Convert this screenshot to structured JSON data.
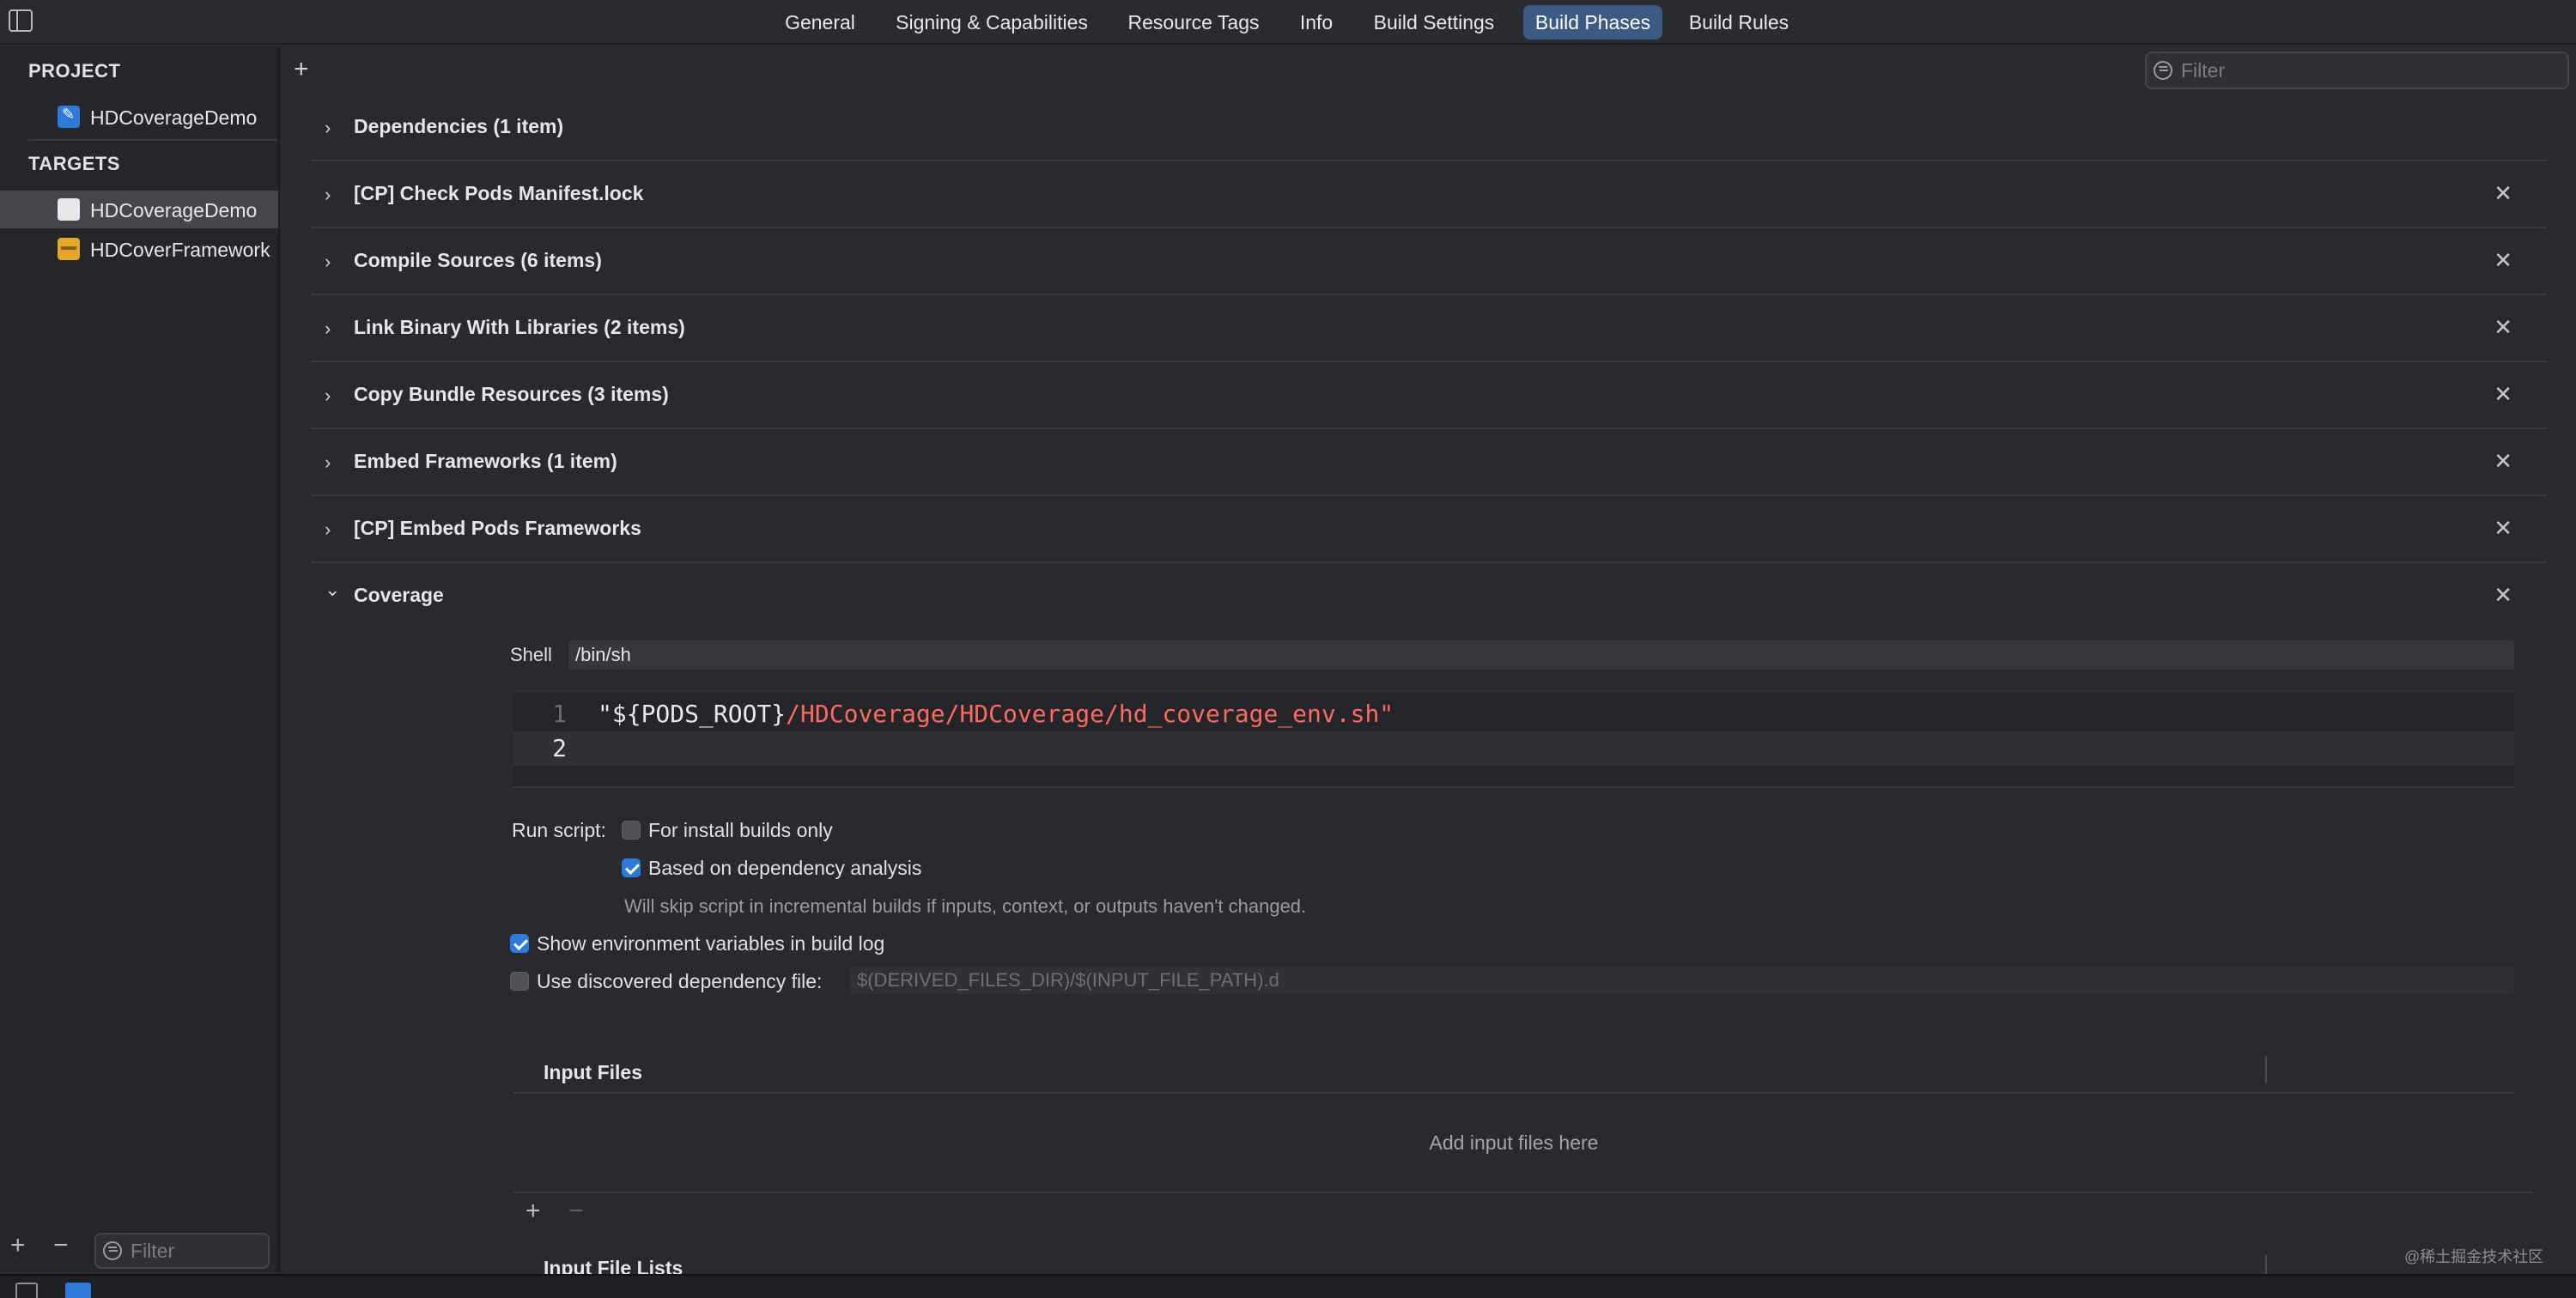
{
  "top_tabs": {
    "general": "General",
    "signing": "Signing & Capabilities",
    "resource_tags": "Resource Tags",
    "info": "Info",
    "build_settings": "Build Settings",
    "build_phases": "Build Phases",
    "build_rules": "Build Rules",
    "active": "Build Phases"
  },
  "search": {
    "filter_placeholder": "Filter"
  },
  "sidebar": {
    "project_heading": "PROJECT",
    "project_item": "HDCoverageDemo",
    "targets_heading": "TARGETS",
    "targets": [
      {
        "label": "HDCoverageDemo",
        "selected": true
      },
      {
        "label": "HDCoverFramework",
        "selected": false
      }
    ],
    "add_symbol": "+",
    "remove_symbol": "−",
    "filter_placeholder": "Filter"
  },
  "main": {
    "add_symbol": "+",
    "phases": [
      {
        "title": "Dependencies (1 item)",
        "closable": false
      },
      {
        "title": "[CP] Check Pods Manifest.lock",
        "closable": true
      },
      {
        "title": "Compile Sources (6 items)",
        "closable": true
      },
      {
        "title": "Link Binary With Libraries (2 items)",
        "closable": true
      },
      {
        "title": "Copy Bundle Resources (3 items)",
        "closable": true
      },
      {
        "title": "Embed Frameworks (1 item)",
        "closable": true
      },
      {
        "title": "[CP] Embed Pods Frameworks",
        "closable": true
      },
      {
        "title": "Coverage",
        "closable": true,
        "expanded": true
      }
    ],
    "chevron_collapsed": "›",
    "chevron_expanded": "⌄",
    "close_symbol": "✕"
  },
  "script_phase": {
    "shell_label": "Shell",
    "shell_value": "/bin/sh",
    "code_lines": [
      {
        "number": "1",
        "plain": "\"${PODS_ROOT}",
        "string": "/HDCoverage/HDCoverage/hd_coverage_env.sh\""
      },
      {
        "number": "2",
        "plain": "",
        "string": ""
      }
    ],
    "run_script_label": "Run script:",
    "install_builds_only": "For install builds only",
    "install_builds_only_checked": false,
    "dependency_analysis": "Based on dependency analysis",
    "dependency_analysis_checked": true,
    "dependency_note": "Will skip script in incremental builds if inputs, context, or outputs haven't changed.",
    "show_env_vars": "Show environment variables in build log",
    "show_env_vars_checked": true,
    "use_dep_file": "Use discovered dependency file:",
    "use_dep_file_checked": false,
    "dep_file_placeholder": "$(DERIVED_FILES_DIR)/$(INPUT_FILE_PATH).d",
    "input_files_header": "Input Files",
    "input_files_empty": "Add input files here",
    "files_add_symbol": "+",
    "files_remove_symbol": "−",
    "input_file_lists_header": "Input File Lists"
  },
  "watermark": "@稀土掘金技术社区",
  "colors": {
    "accent": "#2f7ad8",
    "active_tab": "#3b5b82",
    "string_token": "#fc6a5d",
    "background": "#292a30"
  }
}
